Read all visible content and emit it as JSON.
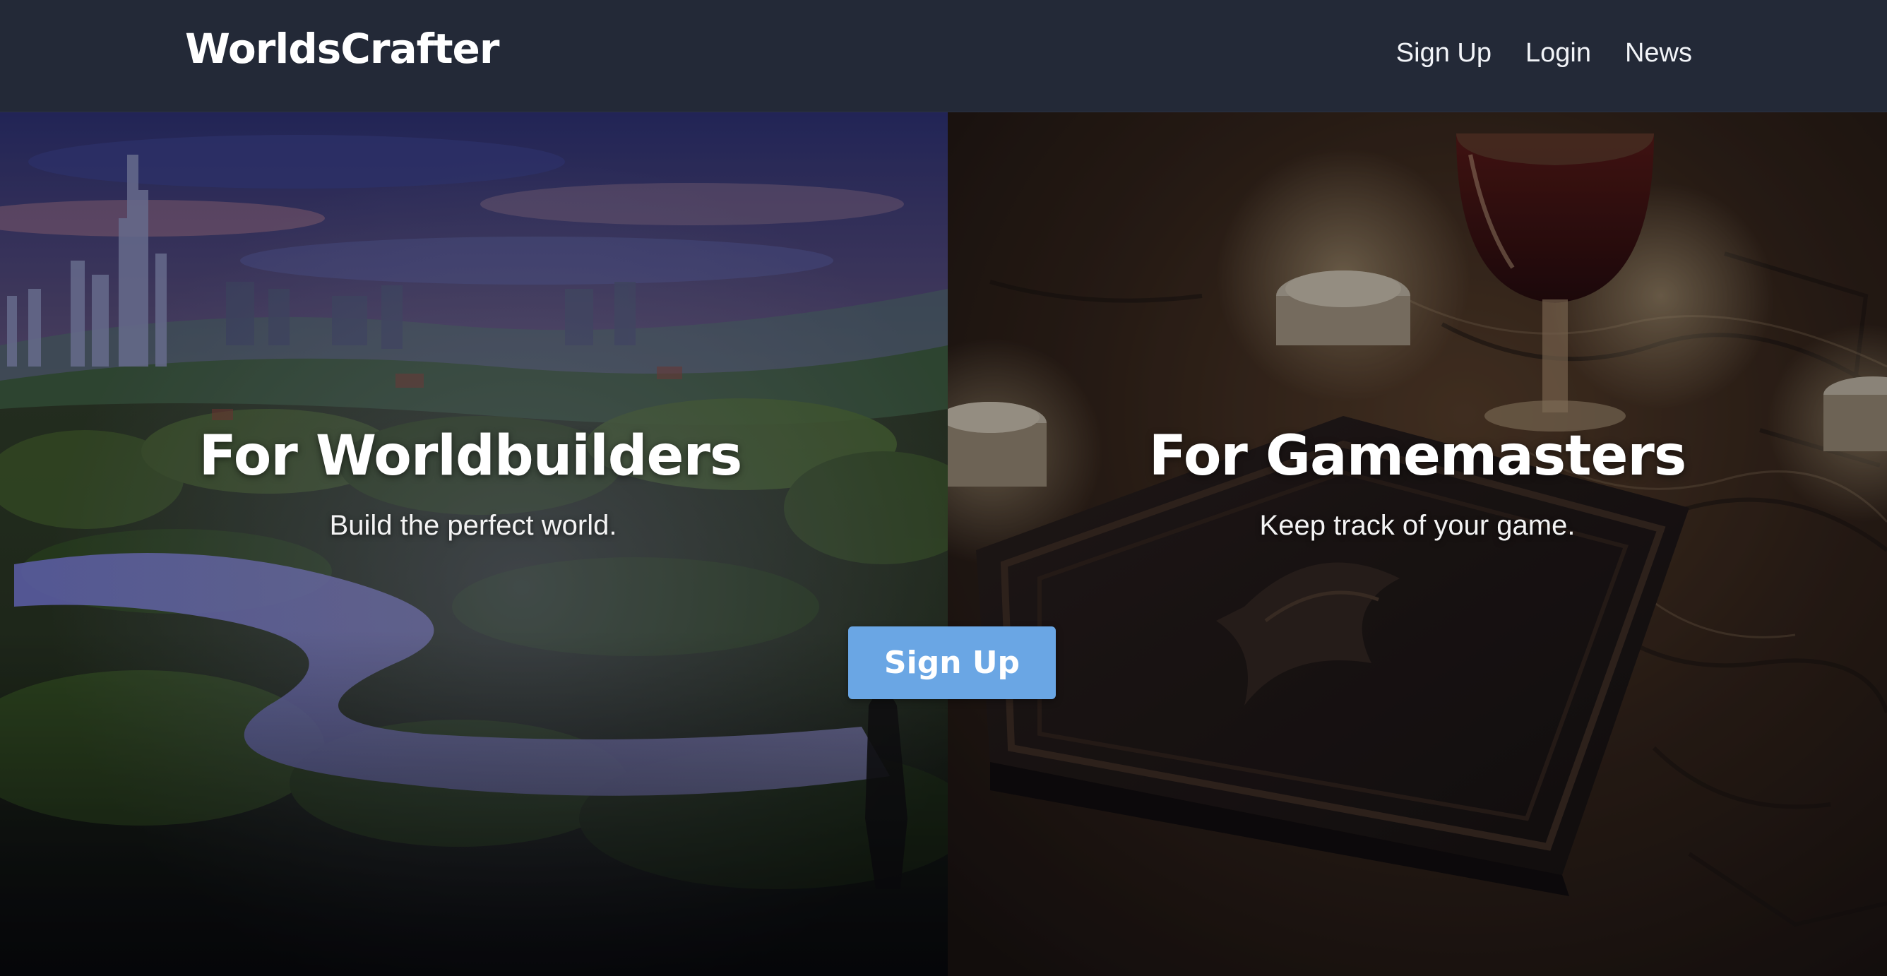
{
  "header": {
    "brand": "WorldsCrafter",
    "nav": {
      "signup": "Sign Up",
      "login": "Login",
      "news": "News"
    },
    "background_color": "#232937"
  },
  "hero": {
    "left": {
      "title": "For Worldbuilders",
      "subtitle": "Build the perfect world.",
      "image": "fantasy-landscape-painting"
    },
    "right": {
      "title": "For Gamemasters",
      "subtitle": "Keep track of your game.",
      "image": "candlelit-tabletop-book"
    },
    "cta_label": "Sign Up",
    "cta_color": "#6aa6e4"
  }
}
